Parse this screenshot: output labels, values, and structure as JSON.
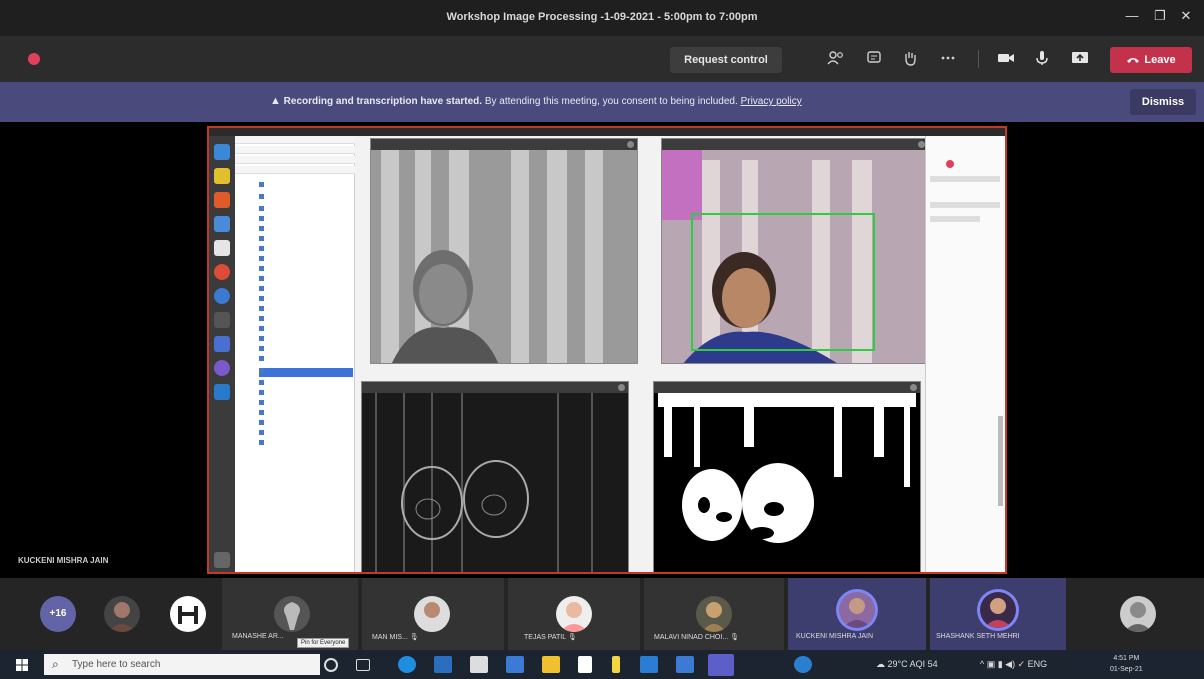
{
  "window": {
    "title": "Workshop Image Processing -1-09-2021 - 5:00pm to 7:00pm",
    "controls": {
      "minimize": "—",
      "maximize": "❐",
      "close": "✕"
    }
  },
  "toolbar": {
    "request_control": "Request control",
    "leave": "Leave",
    "icons": [
      "people-icon",
      "chat-icon",
      "raise-hand-icon",
      "more-icon",
      "camera-icon",
      "mic-icon",
      "share-icon"
    ]
  },
  "banner": {
    "bold": "Recording and transcription have started.",
    "text": " By attending this meeting, you consent to being included.",
    "link": "Privacy policy",
    "dismiss": "Dismiss"
  },
  "stage": {
    "presenter": "KUCKENI MISHRA JAIN"
  },
  "participants": {
    "more": "+16",
    "items": [
      {
        "label": "MANASHE AR..."
      },
      {
        "label": "MAN MIS..."
      },
      {
        "label": "TEJAS PATIL"
      },
      {
        "label": "MALAVI NINAD CHOI..."
      },
      {
        "label": "KUCKENI MISHRA JAIN"
      },
      {
        "label": "SHASHANK SETH MEHRI"
      }
    ],
    "tooltip": "Pin for Everyone"
  },
  "taskbar": {
    "search_placeholder": "Type here to search",
    "weather": "29°C  AQI 54",
    "lang": "ENG",
    "time": "4:51 PM",
    "date": "01-Sep-21"
  }
}
